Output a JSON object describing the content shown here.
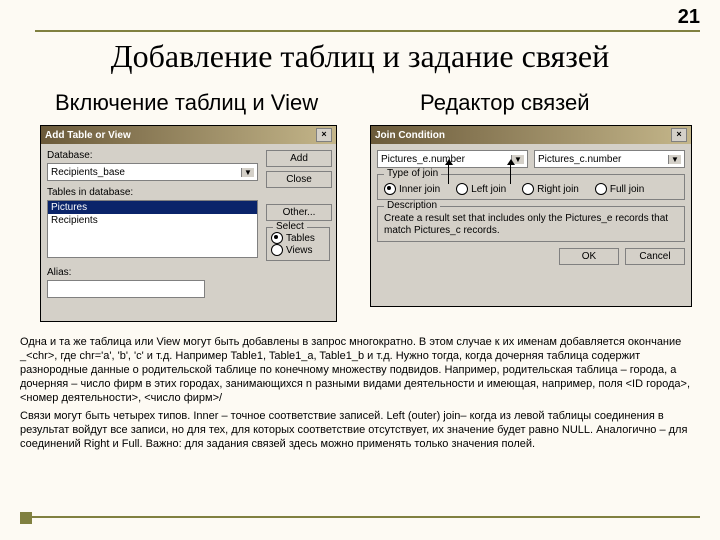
{
  "page_number": "21",
  "title": "Добавление таблиц и задание связей",
  "subtitles": {
    "left": "Включение таблиц и View",
    "right": "Редактор связей"
  },
  "add_dialog": {
    "title": "Add Table or View",
    "db_label": "Database:",
    "db_value": "Recipients_base",
    "tables_label": "Tables in database:",
    "items": [
      "Pictures",
      "Recipients"
    ],
    "selected": "Pictures",
    "buttons": {
      "add": "Add",
      "close": "Close",
      "other": "Other..."
    },
    "select_group": "Select",
    "radio_tables": "Tables",
    "radio_views": "Views",
    "alias_label": "Alias:",
    "alias_value": ""
  },
  "join_dialog": {
    "title": "Join Condition",
    "left_field": "Pictures_e.number",
    "right_field": "Pictures_c.number",
    "type_label": "Type of join",
    "radios": {
      "inner": "Inner join",
      "left": "Left join",
      "right": "Right join",
      "full": "Full join"
    },
    "desc_label": "Description",
    "desc_text": "Create a result set that includes only the Pictures_e records that match Pictures_c records.",
    "ok": "OK",
    "cancel": "Cancel"
  },
  "paragraphs": {
    "p1": "Одна и та же таблица или View могут быть добавлены в запрос многократно. В этом случае к их именам добавляется окончание _<chr>, где chr='a', 'b', 'c' и т.д. Например Table1, Table1_a, Table1_b и т.д. Нужно тогда, когда дочерняя таблица содержит разнородные данные о родительской таблице по конечному множеству подвидов. Например, родительская таблица – города, а дочерняя – число фирм в этих городах, занимающихся n разными видами деятельности и имеющая, например, поля <ID города>, <номер деятельности>, <число фирм>/",
    "p2": "Связи могут быть четырех типов. Inner – точное соответствие записей. Left (outer) join– когда из левой таблицы соединения в результат войдут все записи, но для тех, для которых соответствие отсутствует, их значение будет равно NULL. Аналогично – для соединений Right и Full. Важно: для задания связей здесь можно применять только значения полей."
  }
}
